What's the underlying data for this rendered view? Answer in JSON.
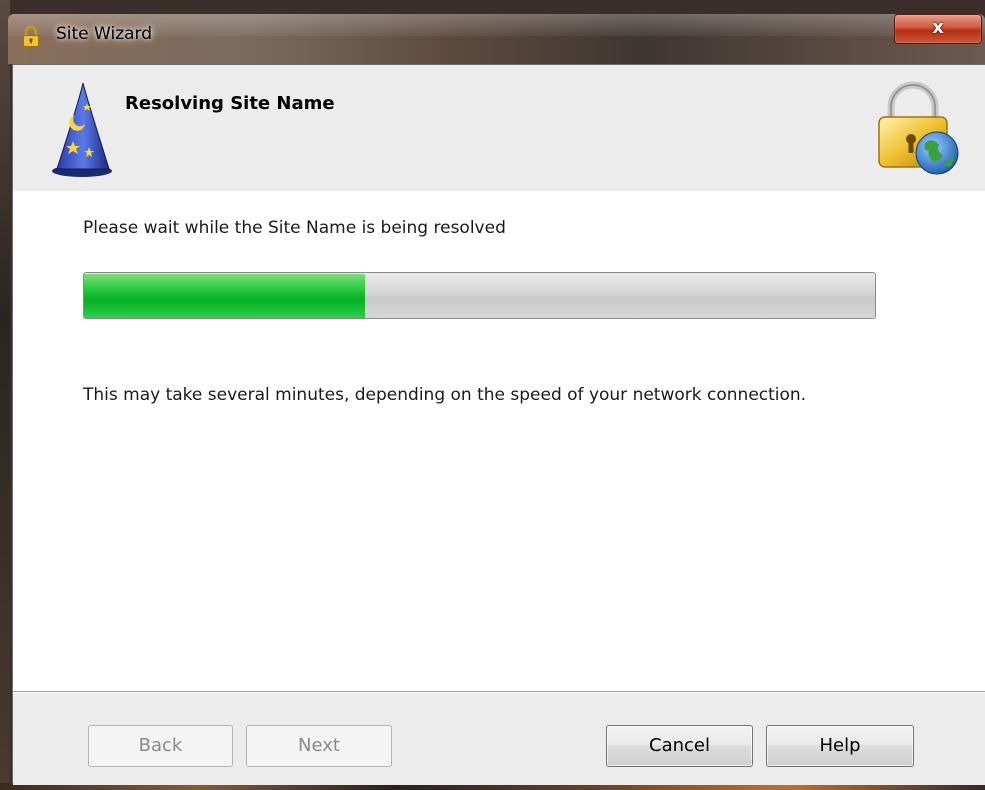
{
  "window": {
    "title": "Site Wizard",
    "close_label": "x"
  },
  "header": {
    "title": "Resolving Site Name"
  },
  "main": {
    "status_text": "Please wait while the Site Name is being resolved",
    "progress_fraction": 0.355,
    "note_text": "This may take several minutes, depending on the speed of your network connection."
  },
  "footer": {
    "back_label": "Back",
    "next_label": "Next",
    "cancel_label": "Cancel",
    "help_label": "Help"
  },
  "colors": {
    "progress_green": "#22c43a",
    "close_red": "#c8452a",
    "header_bg": "#ececec"
  },
  "icons": {
    "title": "padlock-icon",
    "wizard": "wizard-hat-icon",
    "header_right": "lock-globe-icon"
  }
}
